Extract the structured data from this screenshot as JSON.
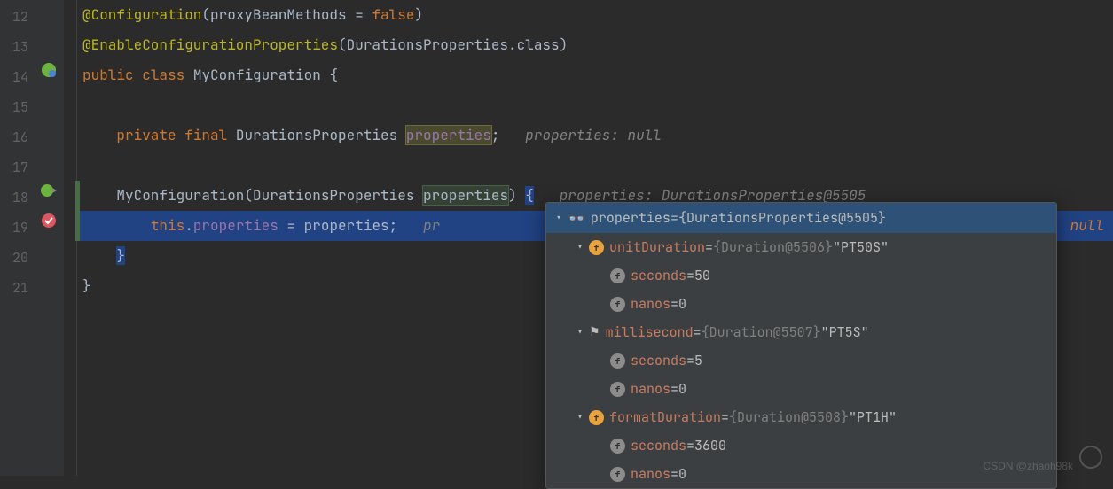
{
  "lines": {
    "start": 12,
    "end": 21
  },
  "code": {
    "l12": {
      "ann": "@Configuration",
      "arg_key": "proxyBeanMethods",
      "arg_op": " = ",
      "arg_val": "false"
    },
    "l13": {
      "ann": "@EnableConfigurationProperties",
      "cls": "DurationsProperties",
      "suffix": ".class"
    },
    "l14": {
      "kw1": "public",
      "kw2": "class",
      "name": "MyConfiguration",
      "brace": "{"
    },
    "l16": {
      "kw1": "private",
      "kw2": "final",
      "type": "DurationsProperties",
      "name": "properties",
      "hint": "properties: null"
    },
    "l18": {
      "name": "MyConfiguration",
      "type": "DurationsProperties",
      "param": "properties",
      "brace": "{",
      "hint": "properties: DurationsProperties@5505"
    },
    "l19": {
      "kw": "this",
      "dot": ".",
      "field": "properties",
      "op": " = ",
      "rhs": "properties",
      "semi": ";",
      "hint": "pr"
    },
    "l20": {
      "brace": "}"
    },
    "l21": {
      "brace": "}"
    }
  },
  "debug": {
    "root": {
      "name": "properties",
      "type": "{DurationsProperties@5505}"
    },
    "n1": {
      "name": "unitDuration",
      "type": "{Duration@5506}",
      "val": "\"PT50S\""
    },
    "n1a": {
      "name": "seconds",
      "val": "50"
    },
    "n1b": {
      "name": "nanos",
      "val": "0"
    },
    "n2": {
      "name": "millisecond",
      "type": "{Duration@5507}",
      "val": "\"PT5S\""
    },
    "n2a": {
      "name": "seconds",
      "val": "5"
    },
    "n2b": {
      "name": "nanos",
      "val": "0"
    },
    "n3": {
      "name": "formatDuration",
      "type": "{Duration@5508}",
      "val": "\"PT1H\""
    },
    "n3a": {
      "name": "seconds",
      "val": "3600"
    },
    "n3b": {
      "name": "nanos",
      "val": "0"
    }
  },
  "null_badge": "null",
  "watermark": "CSDN @zhaoh98k"
}
